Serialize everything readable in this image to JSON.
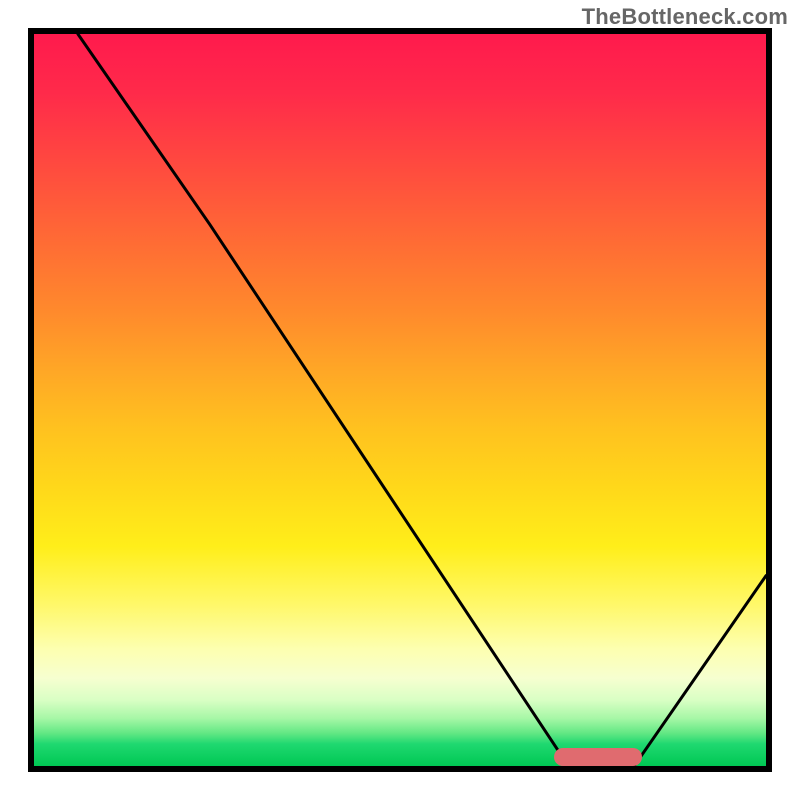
{
  "watermark": "TheBottleneck.com",
  "chart_data": {
    "type": "line",
    "title": "",
    "xlabel": "",
    "ylabel": "",
    "xlim": [
      0,
      100
    ],
    "ylim": [
      0,
      100
    ],
    "grid": false,
    "legend": false,
    "series": [
      {
        "name": "bottleneck-curve",
        "color": "#000000",
        "x": [
          6,
          24,
          73,
          82,
          100
        ],
        "y": [
          100,
          74,
          0,
          0,
          26
        ]
      }
    ],
    "marker": {
      "name": "optimal-range",
      "color": "#e06b6f",
      "x_start": 71,
      "x_end": 83,
      "y": 1.2,
      "height_pct": 2.4
    },
    "gradient_stops": [
      {
        "pct": 0,
        "color": "#ff1a4d"
      },
      {
        "pct": 18,
        "color": "#ff4a3f"
      },
      {
        "pct": 38,
        "color": "#ff8a2c"
      },
      {
        "pct": 54,
        "color": "#ffc21f"
      },
      {
        "pct": 70,
        "color": "#ffee1a"
      },
      {
        "pct": 84,
        "color": "#fdffb0"
      },
      {
        "pct": 93.5,
        "color": "#a6f7a6"
      },
      {
        "pct": 100,
        "color": "#00c853"
      }
    ]
  }
}
